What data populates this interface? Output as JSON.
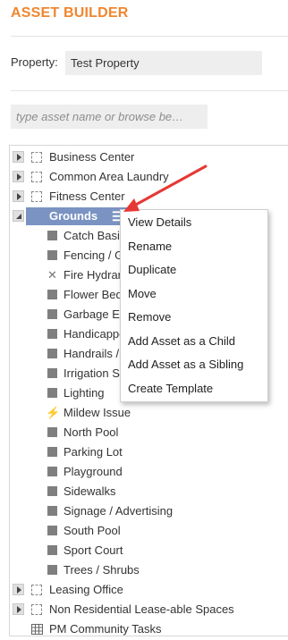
{
  "header": {
    "title": "ASSET BUILDER"
  },
  "property": {
    "label": "Property:",
    "value": "Test Property"
  },
  "search": {
    "placeholder": "type asset name or browse be…"
  },
  "tree": {
    "top_items": [
      {
        "label": "Business Center",
        "state": "collapsed"
      },
      {
        "label": "Common Area Laundry",
        "state": "collapsed"
      },
      {
        "label": "Fitness Center",
        "state": "collapsed"
      }
    ],
    "selected": {
      "label": "Grounds",
      "state": "expanded",
      "menu_icon": "menu-icon"
    },
    "children": [
      {
        "label": "Catch Basins",
        "icon": "square-icon"
      },
      {
        "label": "Fencing / Gates",
        "icon": "square-icon"
      },
      {
        "label": "Fire Hydrants",
        "icon": "wrench-icon"
      },
      {
        "label": "Flower Beds",
        "icon": "square-icon"
      },
      {
        "label": "Garbage Enclosures",
        "icon": "square-icon"
      },
      {
        "label": "Handicapped",
        "icon": "square-icon"
      },
      {
        "label": "Handrails / Railings",
        "icon": "square-icon"
      },
      {
        "label": "Irrigation System",
        "icon": "square-icon"
      },
      {
        "label": "Lighting",
        "icon": "square-icon"
      },
      {
        "label": "Mildew Issue",
        "icon": "bolt-icon"
      },
      {
        "label": "North Pool",
        "icon": "square-icon"
      },
      {
        "label": "Parking Lot",
        "icon": "square-icon"
      },
      {
        "label": "Playground",
        "icon": "square-icon"
      },
      {
        "label": "Sidewalks",
        "icon": "square-icon"
      },
      {
        "label": "Signage / Advertising",
        "icon": "square-icon"
      },
      {
        "label": "South Pool",
        "icon": "square-icon"
      },
      {
        "label": "Sport Court",
        "icon": "square-icon"
      },
      {
        "label": "Trees / Shrubs",
        "icon": "square-icon"
      }
    ],
    "bottom_items": [
      {
        "label": "Leasing Office",
        "state": "collapsed"
      },
      {
        "label": "Non Residential Lease-able Spaces",
        "state": "collapsed"
      },
      {
        "label": "PM Community Tasks",
        "icon": "grid-icon"
      }
    ]
  },
  "context_menu": {
    "items": [
      "View Details",
      "Rename",
      "Duplicate",
      "Move",
      "Remove",
      "Add Asset as a Child",
      "Add Asset as a Sibling",
      "Create Template"
    ]
  },
  "colors": {
    "accent": "#f0862e",
    "selection": "#7a93c2",
    "annotation_arrow": "#e53935"
  }
}
